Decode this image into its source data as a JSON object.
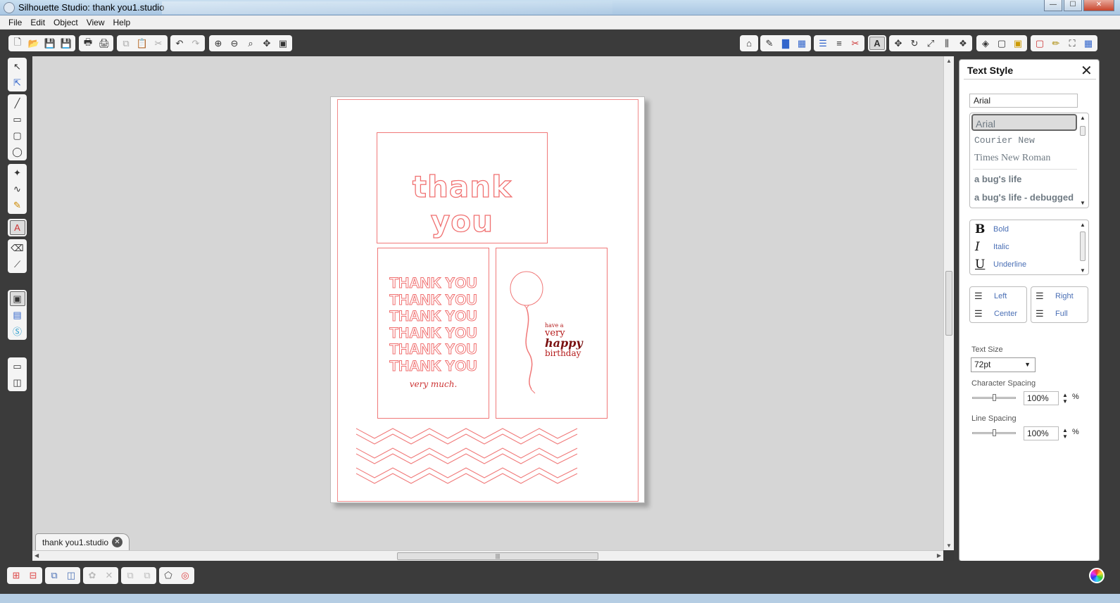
{
  "window": {
    "title": "Silhouette Studio: thank you1.studio",
    "min": "—",
    "max": "☐",
    "close": "✕"
  },
  "menu": [
    "File",
    "Edit",
    "Object",
    "View",
    "Help"
  ],
  "document_tab": {
    "label": "thank you1.studio",
    "close": "✕"
  },
  "design": {
    "big_title": "thank you",
    "thank_lines": [
      "THANK YOU",
      "THANK YOU",
      "THANK YOU",
      "THANK YOU",
      "THANK YOU",
      "THANK YOU"
    ],
    "very_much": "very much.",
    "birthday": {
      "line1": "have a",
      "line2": "very",
      "line3": "happy",
      "line4": "birthday"
    }
  },
  "panel": {
    "title": "Text Style",
    "font_input_value": "Arial",
    "fonts": [
      "Arial",
      "Courier New",
      "Times New Roman",
      "a bug's life",
      "a bug's life - debugged"
    ],
    "styles": [
      {
        "symbol": "B",
        "label": "Bold"
      },
      {
        "symbol": "I",
        "label": "Italic"
      },
      {
        "symbol": "U",
        "label": "Underline"
      }
    ],
    "align_left": [
      {
        "label": "Left"
      },
      {
        "label": "Center"
      }
    ],
    "align_right": [
      {
        "label": "Right"
      },
      {
        "label": "Full"
      }
    ],
    "text_size_label": "Text Size",
    "text_size_value": "72pt",
    "char_spacing_label": "Character Spacing",
    "char_spacing_value": "100%",
    "line_spacing_label": "Line Spacing",
    "line_spacing_value": "100%",
    "percent_sign": "%"
  },
  "colors": {
    "cut_line": "#f07878",
    "dark_red": "#b41a1a",
    "chrome": "#3b3b3b",
    "canvas": "#d6d6d6",
    "link_blue": "#4a6fb5"
  }
}
